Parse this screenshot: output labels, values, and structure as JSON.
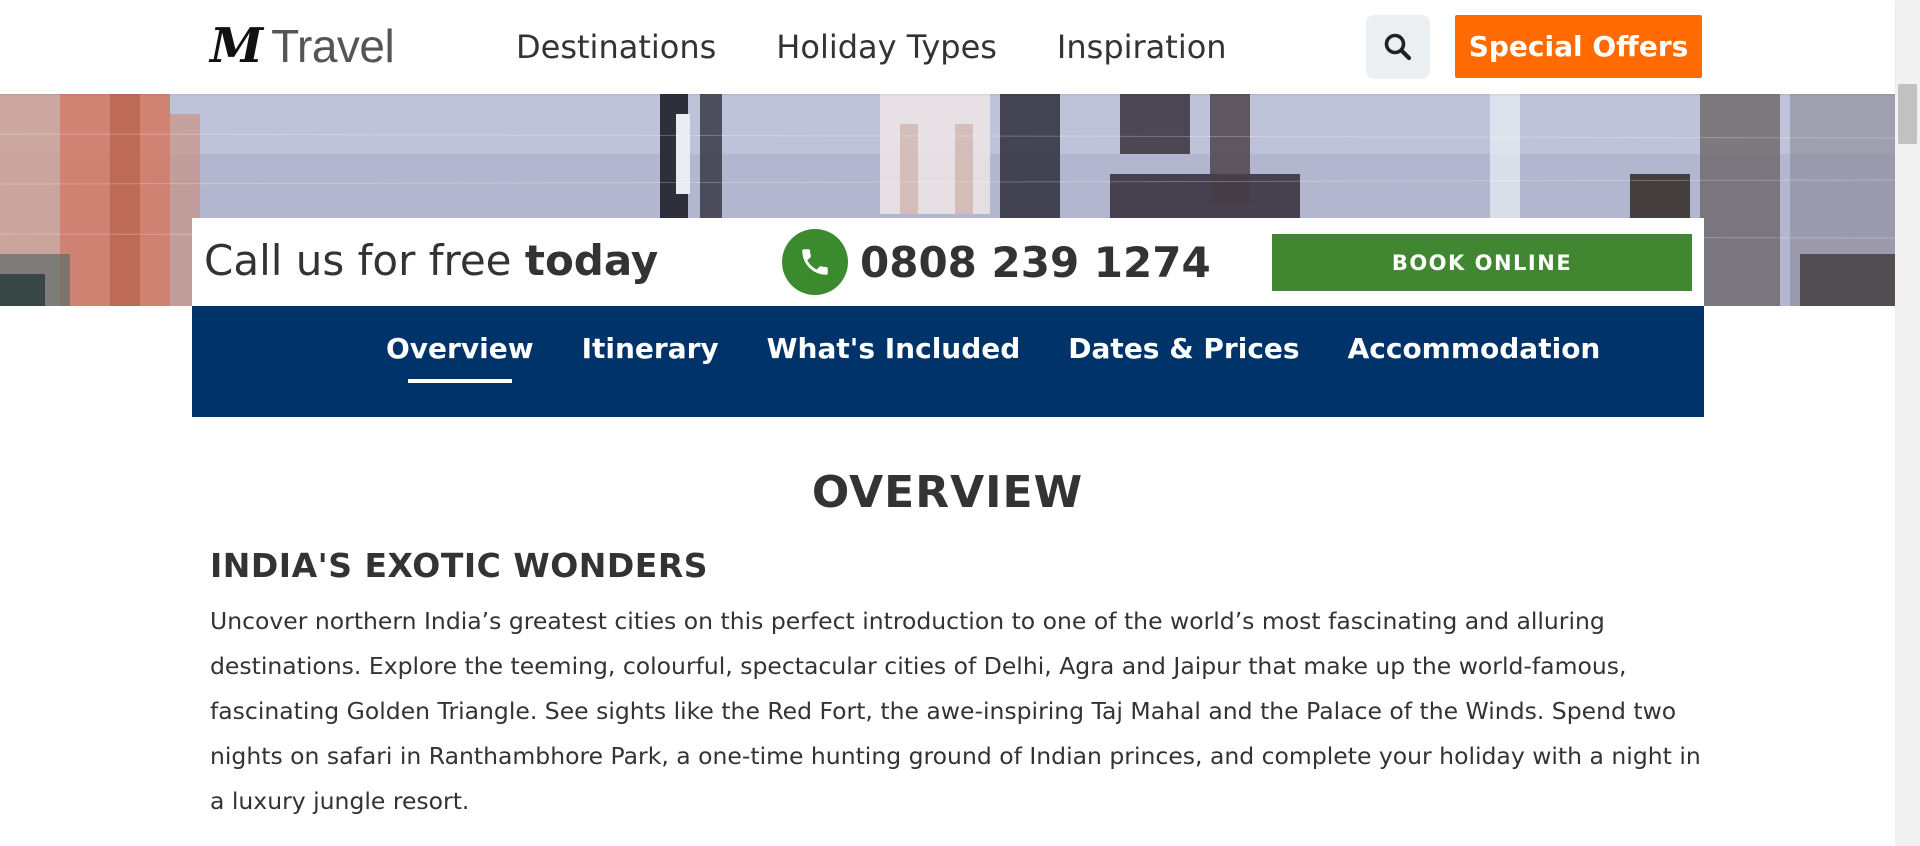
{
  "header": {
    "logo_mark": "M",
    "logo_text": "Travel",
    "nav": [
      "Destinations",
      "Holiday Types",
      "Inspiration"
    ],
    "search_icon": "search-icon",
    "offers_label": "Special Offers"
  },
  "callbar": {
    "text_plain": "Call us for free ",
    "text_bold": "today",
    "phone_icon": "phone-icon",
    "phone_number": "0808 239 1274",
    "book_label": "BOOK ONLINE"
  },
  "tabs": [
    {
      "label": "Overview",
      "active": true
    },
    {
      "label": "Itinerary",
      "active": false
    },
    {
      "label": "What's Included",
      "active": false
    },
    {
      "label": "Dates & Prices",
      "active": false
    },
    {
      "label": "Accommodation",
      "active": false
    }
  ],
  "content": {
    "title": "OVERVIEW",
    "subtitle": "INDIA'S EXOTIC WONDERS",
    "body": "Uncover northern India’s greatest cities on this perfect introduction to one of the world’s most fascinating and alluring destinations. Explore the teeming, colourful, spectacular cities of Delhi, Agra and Jaipur that make up the world-famous, fascinating Golden Triangle. See sights like the Red Fort, the awe-inspiring Taj Mahal and the Palace of the Winds. Spend two nights on safari in Ranthambhore Park, a one-time hunting ground of Indian princes, and complete your holiday with a night in a luxury jungle resort."
  },
  "colors": {
    "accent_orange": "#ff6b00",
    "book_green": "#418630",
    "tab_navy": "#00336a"
  }
}
